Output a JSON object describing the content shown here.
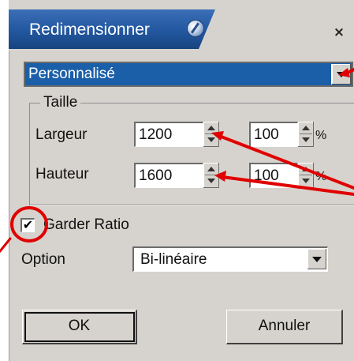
{
  "dialog": {
    "title": "Redimensionner",
    "close_label": "×",
    "preset": {
      "value": "Personnalisé"
    },
    "size_group": {
      "title": "Taille",
      "width": {
        "label": "Largeur",
        "value": "1200",
        "percent": "100",
        "percent_symbol": "%"
      },
      "height": {
        "label": "Hauteur",
        "value": "1600",
        "percent": "100",
        "percent_symbol": "%"
      }
    },
    "keep_ratio": {
      "label": "Garder Ratio",
      "checked": true,
      "check_mark": "✔"
    },
    "option": {
      "label": "Option",
      "value": "Bi-linéaire"
    },
    "buttons": {
      "ok": "OK",
      "cancel": "Annuler"
    }
  },
  "annotations": {
    "color": "#e00000"
  },
  "colors": {
    "title_bar": "#22579f",
    "dialog_bg": "#d6d3ce",
    "preset_bg": "#1b5fa8"
  }
}
